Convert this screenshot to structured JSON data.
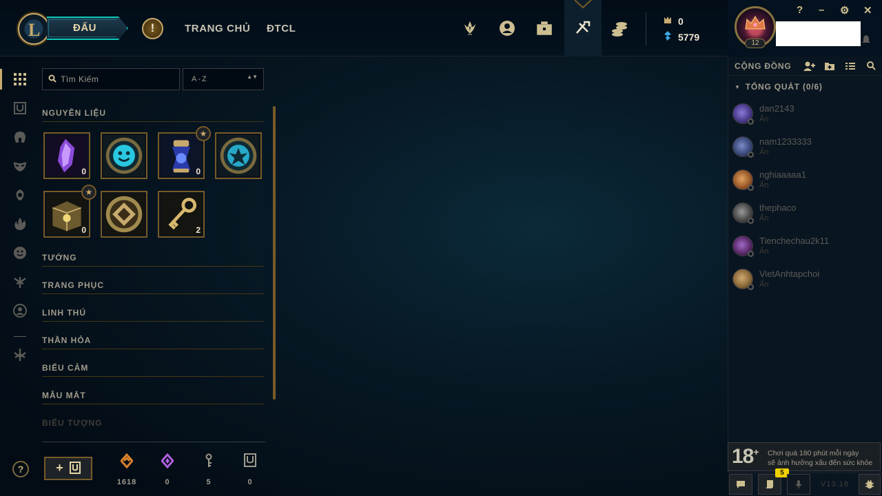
{
  "header": {
    "logo_letter": "L",
    "play_label": "ĐẤU",
    "alert_symbol": "!",
    "nav_links": [
      "TRANG CHỦ",
      "ĐTCL"
    ],
    "nav_icons": [
      "ranked-trophy-icon",
      "profile-icon",
      "collection-bag-icon",
      "loot-icon",
      "store-coins-icon"
    ],
    "currency": {
      "rp": "0",
      "blue_essence": "5779"
    }
  },
  "profile": {
    "level": "12"
  },
  "window_controls": {
    "help": "?",
    "minimize": "–",
    "settings": "⚙",
    "close": "✕"
  },
  "loot": {
    "search_placeholder": "Tìm Kiếm",
    "sort_value": "A-Z",
    "sort_arrows": "▲▼",
    "sections": [
      "NGUYÊN LIỆU",
      "TƯỚNG",
      "TRANG PHỤC",
      "LINH THÚ",
      "THẦN HỎA",
      "BIỂU CẢM",
      "MẪU MẮT",
      "BIỂU TƯỢNG"
    ],
    "materials": [
      {
        "name": "mythic-essence",
        "count": "0",
        "star": false
      },
      {
        "name": "emote-token",
        "count": "",
        "star": false
      },
      {
        "name": "event-token",
        "count": "0",
        "star": true
      },
      {
        "name": "ward-token",
        "count": "",
        "star": false
      },
      {
        "name": "hextech-chest",
        "count": "0",
        "star": true
      },
      {
        "name": "mastery-token",
        "count": "",
        "star": false
      },
      {
        "name": "hextech-key",
        "count": "2",
        "star": false
      }
    ],
    "craft_label": "+",
    "wallet": [
      {
        "icon": "orange-essence-icon",
        "value": "1618",
        "color": "#d9822b"
      },
      {
        "icon": "mythic-essence-icon",
        "value": "0",
        "color": "#b060e0"
      },
      {
        "icon": "key-fragment-icon",
        "value": "5",
        "color": "#a09b8c"
      },
      {
        "icon": "chest-icon",
        "value": "0",
        "color": "#a09b8c"
      }
    ]
  },
  "social": {
    "title": "CỘNG ĐỒNG",
    "group": "TỔNG QUÁT (0/6)",
    "friends": [
      {
        "name": "dan2143",
        "status": "Ẩn",
        "color": "#4a3a8a"
      },
      {
        "name": "nam1233333",
        "status": "Ẩn",
        "color": "#3a4a7a"
      },
      {
        "name": "nghiaaaaa1",
        "status": "Ẩn",
        "color": "#9a5a2a"
      },
      {
        "name": "thephaco",
        "status": "Ẩn",
        "color": "#4a4a4a"
      },
      {
        "name": "Tienchechau2k11",
        "status": "Ẩn",
        "color": "#5a2a6a"
      },
      {
        "name": "VietAnhtapchoi",
        "status": "Ẩn",
        "color": "#8a6a3a"
      }
    ]
  },
  "notice": {
    "age": "18",
    "age_plus": "+",
    "line1": "Chơi quá 180 phút mỗi ngày",
    "line2": "sẽ ảnh hưởng xấu đến sức khỏe"
  },
  "dock": {
    "badge": "5",
    "version": "V13.18"
  }
}
